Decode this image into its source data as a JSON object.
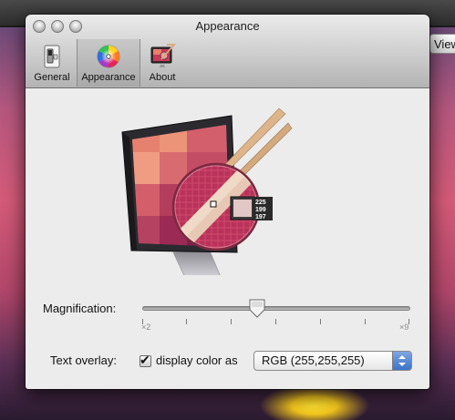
{
  "window": {
    "title": "Appearance"
  },
  "toolbar": {
    "items": [
      {
        "label": "General",
        "icon": "light-switch-icon"
      },
      {
        "label": "Appearance",
        "icon": "color-wheel-icon",
        "selected": true
      },
      {
        "label": "About",
        "icon": "app-icon"
      }
    ]
  },
  "preview": {
    "sample_rgb": [
      "225",
      "199",
      "197"
    ],
    "sample_color": "#e1c7c5"
  },
  "magnification": {
    "label": "Magnification:",
    "min_label": "×2",
    "max_label": "×9",
    "value_fraction": 0.43
  },
  "text_overlay": {
    "label": "Text overlay:",
    "checkbox_label": "display color as",
    "checked": true,
    "format_selected": "RGB (255,255,255)"
  },
  "background": {
    "view_button_label": "View"
  }
}
